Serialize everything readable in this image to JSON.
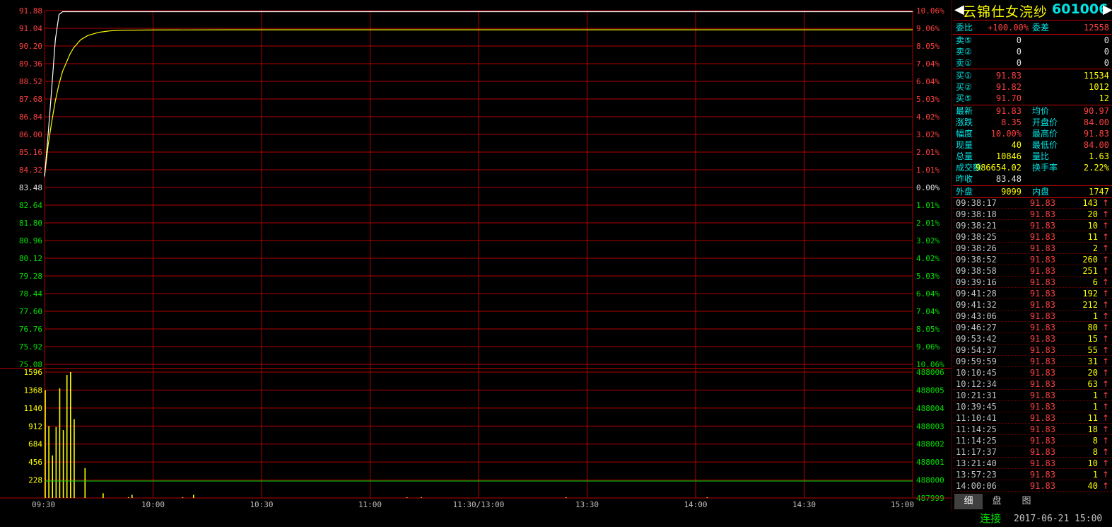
{
  "chart_data": {
    "type": "line",
    "price_axis": {
      "prev_close": "83.48",
      "left_labels": [
        "91.88",
        "91.04",
        "90.20",
        "89.36",
        "88.52",
        "87.68",
        "86.84",
        "86.00",
        "85.16",
        "84.32",
        "83.48",
        "82.64",
        "81.80",
        "80.96",
        "80.12",
        "79.28",
        "78.44",
        "77.60",
        "76.76",
        "75.92",
        "75.08"
      ],
      "right_labels": [
        "10.06%",
        "9.06%",
        "8.05%",
        "7.04%",
        "6.04%",
        "5.03%",
        "4.02%",
        "3.02%",
        "2.01%",
        "1.01%",
        "0.00%",
        "1.01%",
        "2.01%",
        "3.02%",
        "4.02%",
        "5.03%",
        "6.04%",
        "7.04%",
        "8.05%",
        "9.06%",
        "10.06%"
      ],
      "ylim": [
        75.08,
        91.88
      ]
    },
    "volume_axis": {
      "left_labels": [
        "1596",
        "1368",
        "1140",
        "912",
        "684",
        "456",
        "228"
      ],
      "right_labels": [
        "488006",
        "488005",
        "488004",
        "488003",
        "488002",
        "488001",
        "488000",
        "487999"
      ],
      "ylim": [
        0,
        1596
      ]
    },
    "time_labels": [
      "09:30",
      "10:00",
      "10:30",
      "11:00",
      "11:30/13:00",
      "13:30",
      "14:00",
      "14:30",
      "15:00"
    ],
    "total_minutes": 240,
    "price_series": [
      [
        0,
        84.0
      ],
      [
        1,
        86.0
      ],
      [
        2,
        88.2
      ],
      [
        3,
        90.5
      ],
      [
        4,
        91.7
      ],
      [
        5,
        91.83
      ],
      [
        240,
        91.83
      ]
    ],
    "avg_series": [
      [
        0,
        84.0
      ],
      [
        1,
        85.5
      ],
      [
        2,
        86.6
      ],
      [
        3,
        87.6
      ],
      [
        4,
        88.4
      ],
      [
        5,
        89.0
      ],
      [
        6,
        89.4
      ],
      [
        7,
        89.8
      ],
      [
        8,
        90.1
      ],
      [
        9,
        90.3
      ],
      [
        10,
        90.5
      ],
      [
        12,
        90.7
      ],
      [
        15,
        90.85
      ],
      [
        18,
        90.92
      ],
      [
        22,
        90.95
      ],
      [
        30,
        90.96
      ],
      [
        50,
        90.97
      ],
      [
        240,
        90.97
      ]
    ],
    "volume_series": [
      [
        0,
        1368
      ],
      [
        1,
        912
      ],
      [
        2,
        540
      ],
      [
        3,
        900
      ],
      [
        4,
        1390
      ],
      [
        5,
        860
      ],
      [
        6,
        1560
      ],
      [
        7,
        1596
      ],
      [
        8,
        1000
      ],
      [
        11,
        380
      ],
      [
        16,
        60
      ],
      [
        23,
        10
      ],
      [
        24,
        40
      ],
      [
        38,
        10
      ],
      [
        41,
        40
      ],
      [
        100,
        10
      ],
      [
        104,
        10
      ],
      [
        144,
        10
      ],
      [
        183,
        10
      ]
    ],
    "ref_line_value": 228
  },
  "quote": {
    "name": "云锦仕女浣纱",
    "code": "601006",
    "arrow_left": "◀",
    "arrow_right": "▶",
    "weibi": {
      "label": "委比",
      "value": "+100.00%",
      "label2": "委差",
      "value2": "12558"
    },
    "sells": [
      {
        "label": "卖⑤",
        "price": "0",
        "vol": "0"
      },
      {
        "label": "卖②",
        "price": "0",
        "vol": "0"
      },
      {
        "label": "卖①",
        "price": "0",
        "vol": "0"
      }
    ],
    "buys": [
      {
        "label": "买①",
        "price": "91.83",
        "vol": "11534"
      },
      {
        "label": "买②",
        "price": "91.82",
        "vol": "1012"
      },
      {
        "label": "买⑤",
        "price": "91.70",
        "vol": "12"
      }
    ],
    "stats": [
      {
        "l1": "最新",
        "v1": "91.83",
        "c1": "red",
        "l2": "均价",
        "v2": "90.97",
        "c2": "red"
      },
      {
        "l1": "涨跌",
        "v1": "8.35",
        "c1": "red",
        "l2": "开盘价",
        "v2": "84.00",
        "c2": "red"
      },
      {
        "l1": "幅度",
        "v1": "10.00%",
        "c1": "red",
        "l2": "最高价",
        "v2": "91.83",
        "c2": "red"
      },
      {
        "l1": "现量",
        "v1": "40",
        "c1": "yel",
        "l2": "最低价",
        "v2": "84.00",
        "c2": "red"
      },
      {
        "l1": "总量",
        "v1": "10846",
        "c1": "yel",
        "l2": "量比",
        "v2": "1.63",
        "c2": "yel"
      },
      {
        "l1": "成交额",
        "v1": "986654.02",
        "c1": "yel",
        "l2": "换手率",
        "v2": "2.22%",
        "c2": "yel"
      }
    ],
    "prev": {
      "label": "昨收",
      "value": "83.48"
    },
    "waipan": {
      "label": "外盘",
      "value": "9099",
      "label2": "内盘",
      "value2": "1747"
    }
  },
  "ticks": [
    {
      "time": "09:38:17",
      "price": "91.83",
      "vol": "143",
      "dir": "↑"
    },
    {
      "time": "09:38:18",
      "price": "91.83",
      "vol": "20",
      "dir": "↑"
    },
    {
      "time": "09:38:21",
      "price": "91.83",
      "vol": "10",
      "dir": "↑"
    },
    {
      "time": "09:38:25",
      "price": "91.83",
      "vol": "11",
      "dir": "↑"
    },
    {
      "time": "09:38:26",
      "price": "91.83",
      "vol": "2",
      "dir": "↑"
    },
    {
      "time": "09:38:52",
      "price": "91.83",
      "vol": "260",
      "dir": "↑"
    },
    {
      "time": "09:38:58",
      "price": "91.83",
      "vol": "251",
      "dir": "↑"
    },
    {
      "time": "09:39:16",
      "price": "91.83",
      "vol": "6",
      "dir": "↑"
    },
    {
      "time": "09:41:28",
      "price": "91.83",
      "vol": "192",
      "dir": "↑"
    },
    {
      "time": "09:41:32",
      "price": "91.83",
      "vol": "212",
      "dir": "↑"
    },
    {
      "time": "09:43:06",
      "price": "91.83",
      "vol": "1",
      "dir": "↑"
    },
    {
      "time": "09:46:27",
      "price": "91.83",
      "vol": "80",
      "dir": "↑"
    },
    {
      "time": "09:53:42",
      "price": "91.83",
      "vol": "15",
      "dir": "↑"
    },
    {
      "time": "09:54:37",
      "price": "91.83",
      "vol": "55",
      "dir": "↑"
    },
    {
      "time": "09:59:59",
      "price": "91.83",
      "vol": "31",
      "dir": "↑"
    },
    {
      "time": "10:10:45",
      "price": "91.83",
      "vol": "20",
      "dir": "↑"
    },
    {
      "time": "10:12:34",
      "price": "91.83",
      "vol": "63",
      "dir": "↑"
    },
    {
      "time": "10:21:31",
      "price": "91.83",
      "vol": "1",
      "dir": "↑"
    },
    {
      "time": "10:39:45",
      "price": "91.83",
      "vol": "1",
      "dir": "↑"
    },
    {
      "time": "11:10:41",
      "price": "91.83",
      "vol": "11",
      "dir": "↑"
    },
    {
      "time": "11:14:25",
      "price": "91.83",
      "vol": "18",
      "dir": "↑"
    },
    {
      "time": "11:14:25",
      "price": "91.83",
      "vol": "8",
      "dir": "↑"
    },
    {
      "time": "11:17:37",
      "price": "91.83",
      "vol": "8",
      "dir": "↑"
    },
    {
      "time": "13:21:40",
      "price": "91.83",
      "vol": "10",
      "dir": "↑"
    },
    {
      "time": "13:57:23",
      "price": "91.83",
      "vol": "1",
      "dir": "↑"
    },
    {
      "time": "14:00:06",
      "price": "91.83",
      "vol": "40",
      "dir": "↑"
    }
  ],
  "tabs": [
    "细",
    "盘",
    "图"
  ],
  "status": {
    "connection": "连接",
    "datetime": "2017-06-21 15:00"
  },
  "colors": {
    "grid": "#b00000",
    "price_line": "#ffffff",
    "avg_line": "#ffff00",
    "volume": "#ffff00",
    "ref_line": "#00e000",
    "up": "#ff4040",
    "down": "#00e000"
  }
}
